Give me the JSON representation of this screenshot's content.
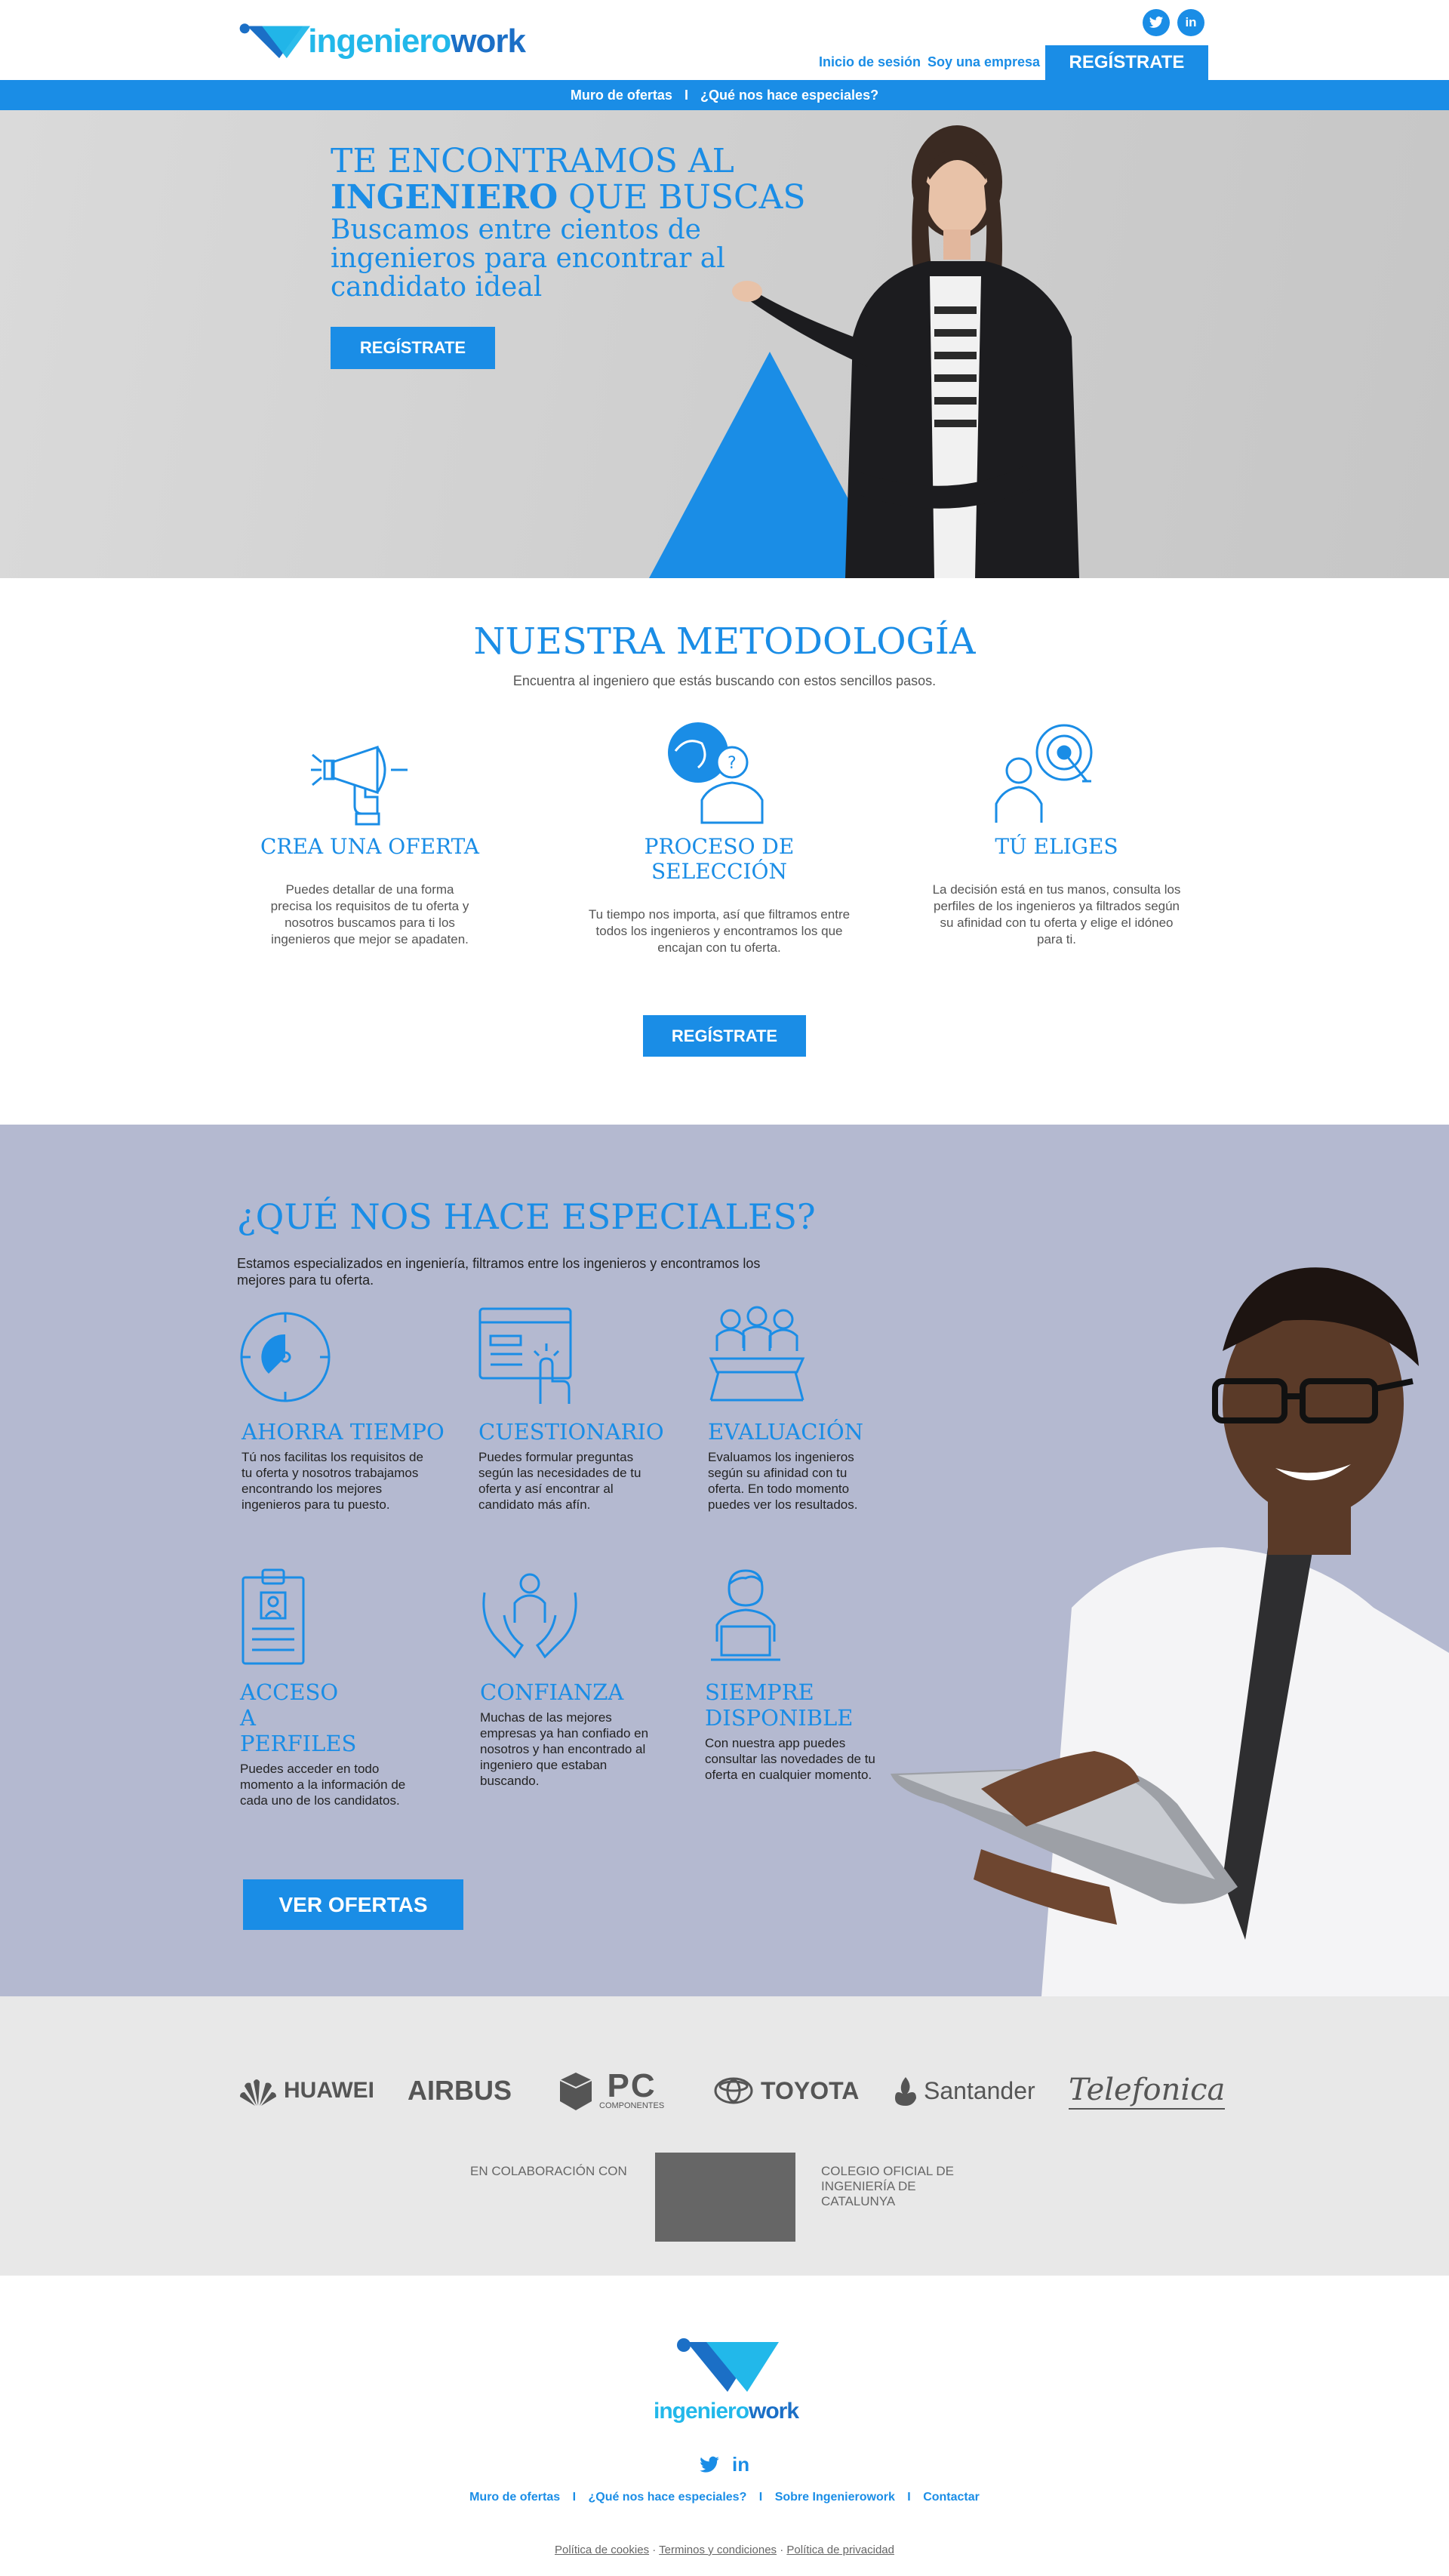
{
  "brand": {
    "logo_a": "ingeniero",
    "logo_b": "work"
  },
  "header": {
    "social": [
      "twitter",
      "linkedin"
    ],
    "login": "Inicio de sesión",
    "company": "Soy una empresa",
    "register": "REGÍSTRATE"
  },
  "nav": {
    "items": [
      "Muro de ofertas",
      "I",
      "¿Qué nos hace especiales?"
    ]
  },
  "hero": {
    "title_line1": "TE ENCONTRAMOS AL",
    "title_bold": "INGENIERO",
    "title_rest": " QUE BUSCAS",
    "subtitle": "Buscamos entre cientos de ingenieros para encontrar al candidato ideal",
    "button": "REGÍSTRATE"
  },
  "methodology": {
    "title": "NUESTRA METODOLOGÍA",
    "subtitle": "Encuentra al ingeniero que estás buscando con estos sencillos pasos.",
    "steps": [
      {
        "icon": "megaphone-icon",
        "name": "CREA UNA OFERTA",
        "desc": "Puedes detallar de una forma precisa los requisitos de tu oferta y nosotros buscamos para ti los ingenieros que mejor se apadaten."
      },
      {
        "icon": "selection-process-icon",
        "name": "PROCESO DE SELECCIÓN",
        "desc": "Tu tiempo nos importa, así que filtramos entre todos los ingenieros y encontramos los que encajan con tu oferta."
      },
      {
        "icon": "target-person-icon",
        "name": "TÚ ELIGES",
        "desc": "La decisión está en tus manos, consulta los perfiles de los ingenieros ya filtrados según su afinidad con tu oferta y elige el idóneo para ti."
      }
    ],
    "button": "REGÍSTRATE"
  },
  "special": {
    "title": "¿QUÉ NOS HACE ESPECIALES?",
    "intro": "Estamos especializados en ingeniería, filtramos entre los ingenieros y encontramos los mejores para tu oferta.",
    "features": [
      {
        "icon": "clock-icon",
        "title": "AHORRA TIEMPO",
        "desc": "Tú nos facilitas los requisitos de tu oferta y nosotros trabajamos encontrando los mejores ingenieros para tu puesto."
      },
      {
        "icon": "form-click-icon",
        "title": "CUESTIONARIO",
        "desc": "Puedes formular preguntas según las necesidades de tu oferta y así encontrar al candidato más afín."
      },
      {
        "icon": "evaluation-panel-icon",
        "title": "EVALUACIÓN",
        "desc": "Evaluamos los ingenieros según su afinidad con tu oferta. En todo momento puedes ver los resultados."
      },
      {
        "icon": "profile-card-icon",
        "title": "ACCESO A PERFILES",
        "desc": "Puedes acceder en todo momento a la información de cada uno de los candidatos."
      },
      {
        "icon": "trust-hands-icon",
        "title": "CONFIANZA",
        "desc": "Muchas de las mejores empresas ya han confiado en nosotros y han encontrado al ingeniero que estaban buscando."
      },
      {
        "icon": "laptop-user-icon",
        "title": "SIEMPRE DISPONIBLE",
        "desc": "Con nuestra app puedes consultar las novedades de tu oferta en cualquier momento."
      }
    ],
    "button": "VER OFERTAS"
  },
  "partners": {
    "brands": [
      "HUAWEI",
      "AIRBUS",
      "PC",
      "TOYOTA",
      "Santander",
      "Telefonica"
    ],
    "pc_sub": "COMPONENTES",
    "collab_label": "EN COLABORACIÓN CON",
    "collab_name": "COLEGIO OFICIAL DE INGENIERÍA DE CATALUNYA"
  },
  "footer": {
    "links": [
      "Muro de ofertas",
      "¿Qué nos hace especiales?",
      "Sobre Ingenierowork",
      "Contactar"
    ],
    "separator": "I",
    "legal": [
      "Política de cookies",
      "Terminos y condiciones",
      "Política de privacidad"
    ]
  },
  "colors": {
    "accent": "#1a8de6",
    "cyan": "#22b8ea",
    "special_bg": "#b4b9d0",
    "partners_bg": "#e8e8e8"
  }
}
